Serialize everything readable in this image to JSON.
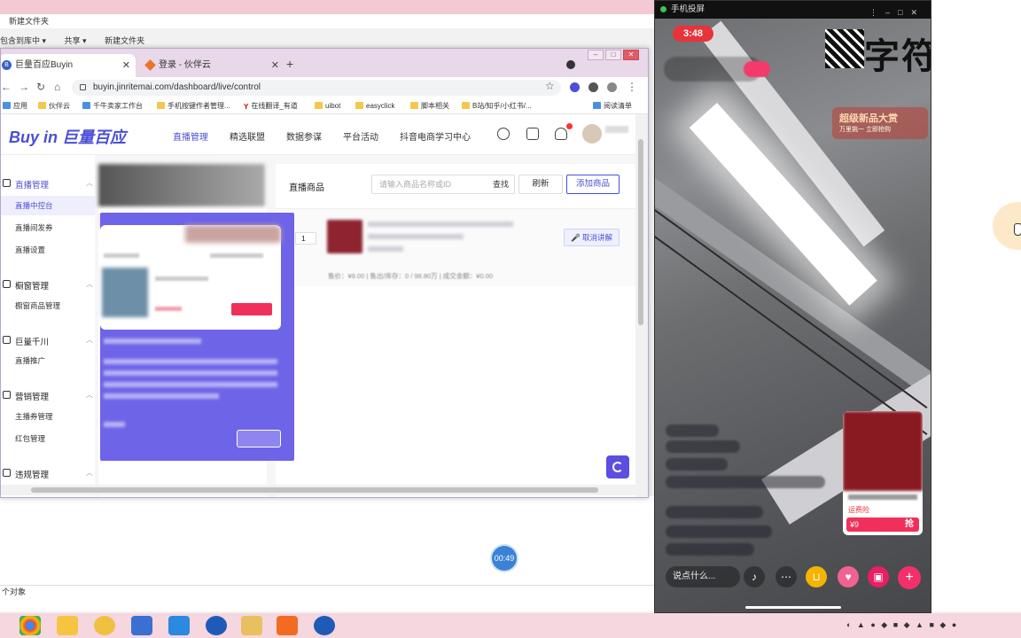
{
  "explorer": {
    "title": "新建文件夹",
    "toolbar": [
      "包含到库中 ▾",
      "共享 ▾",
      "新建文件夹"
    ],
    "status": "个对象"
  },
  "browser": {
    "tabs": [
      {
        "label": "巨量百应Buyin",
        "active": true
      },
      {
        "label": "登录 - 伙伴云",
        "active": false
      }
    ],
    "url": "buyin.jinritemai.com/dashboard/live/control",
    "bookmarks": [
      "应用",
      "伙伴云",
      "千牛卖家工作台",
      "手机按键作者管理...",
      "在线翻译_有道",
      "uibot",
      "easyclick",
      "脚本相关",
      "B站/知乎/小红书/...",
      "阅读清单"
    ]
  },
  "app": {
    "logo": "Buy in 巨量百应",
    "topmenu": [
      "直播管理",
      "精选联盟",
      "数据参谋",
      "平台活动",
      "抖音电商学习中心"
    ],
    "sidebar": [
      {
        "group": "直播管理",
        "items": [
          "直播中控台",
          "直播间发券",
          "直播设置"
        ]
      },
      {
        "group": "橱窗管理",
        "items": [
          "橱窗商品管理"
        ]
      },
      {
        "group": "巨量千川",
        "items": [
          "直播推广"
        ]
      },
      {
        "group": "营销管理",
        "items": [
          "主播券管理",
          "红包管理"
        ]
      },
      {
        "group": "违规管理",
        "items": []
      }
    ],
    "content": {
      "title": "直播商品",
      "search_placeholder": "请输入商品名称或ID",
      "search_btn": "查找",
      "refresh_btn": "刷新",
      "add_btn": "添加商品",
      "row_index": "1",
      "cancel_btn": "取消讲解",
      "stats": "售价：¥9.00  |  售出/库存：0 / 98.80万  |  成交金额：¥0.00"
    }
  },
  "timer": "00:49",
  "phone": {
    "window_title": "手机投屏",
    "time": "3:48",
    "brand": "字符科技",
    "promo_title": "超级新品大赏",
    "promo_sub": "万里挑一 立即抢购",
    "product_tag": "运费险",
    "product_price": "¥9",
    "buy_label": "抢",
    "say_placeholder": "说点什么..."
  },
  "colors": {
    "accent": "#4a4fd6",
    "live_red": "#e8333b",
    "buy_pink": "#f0305a"
  }
}
